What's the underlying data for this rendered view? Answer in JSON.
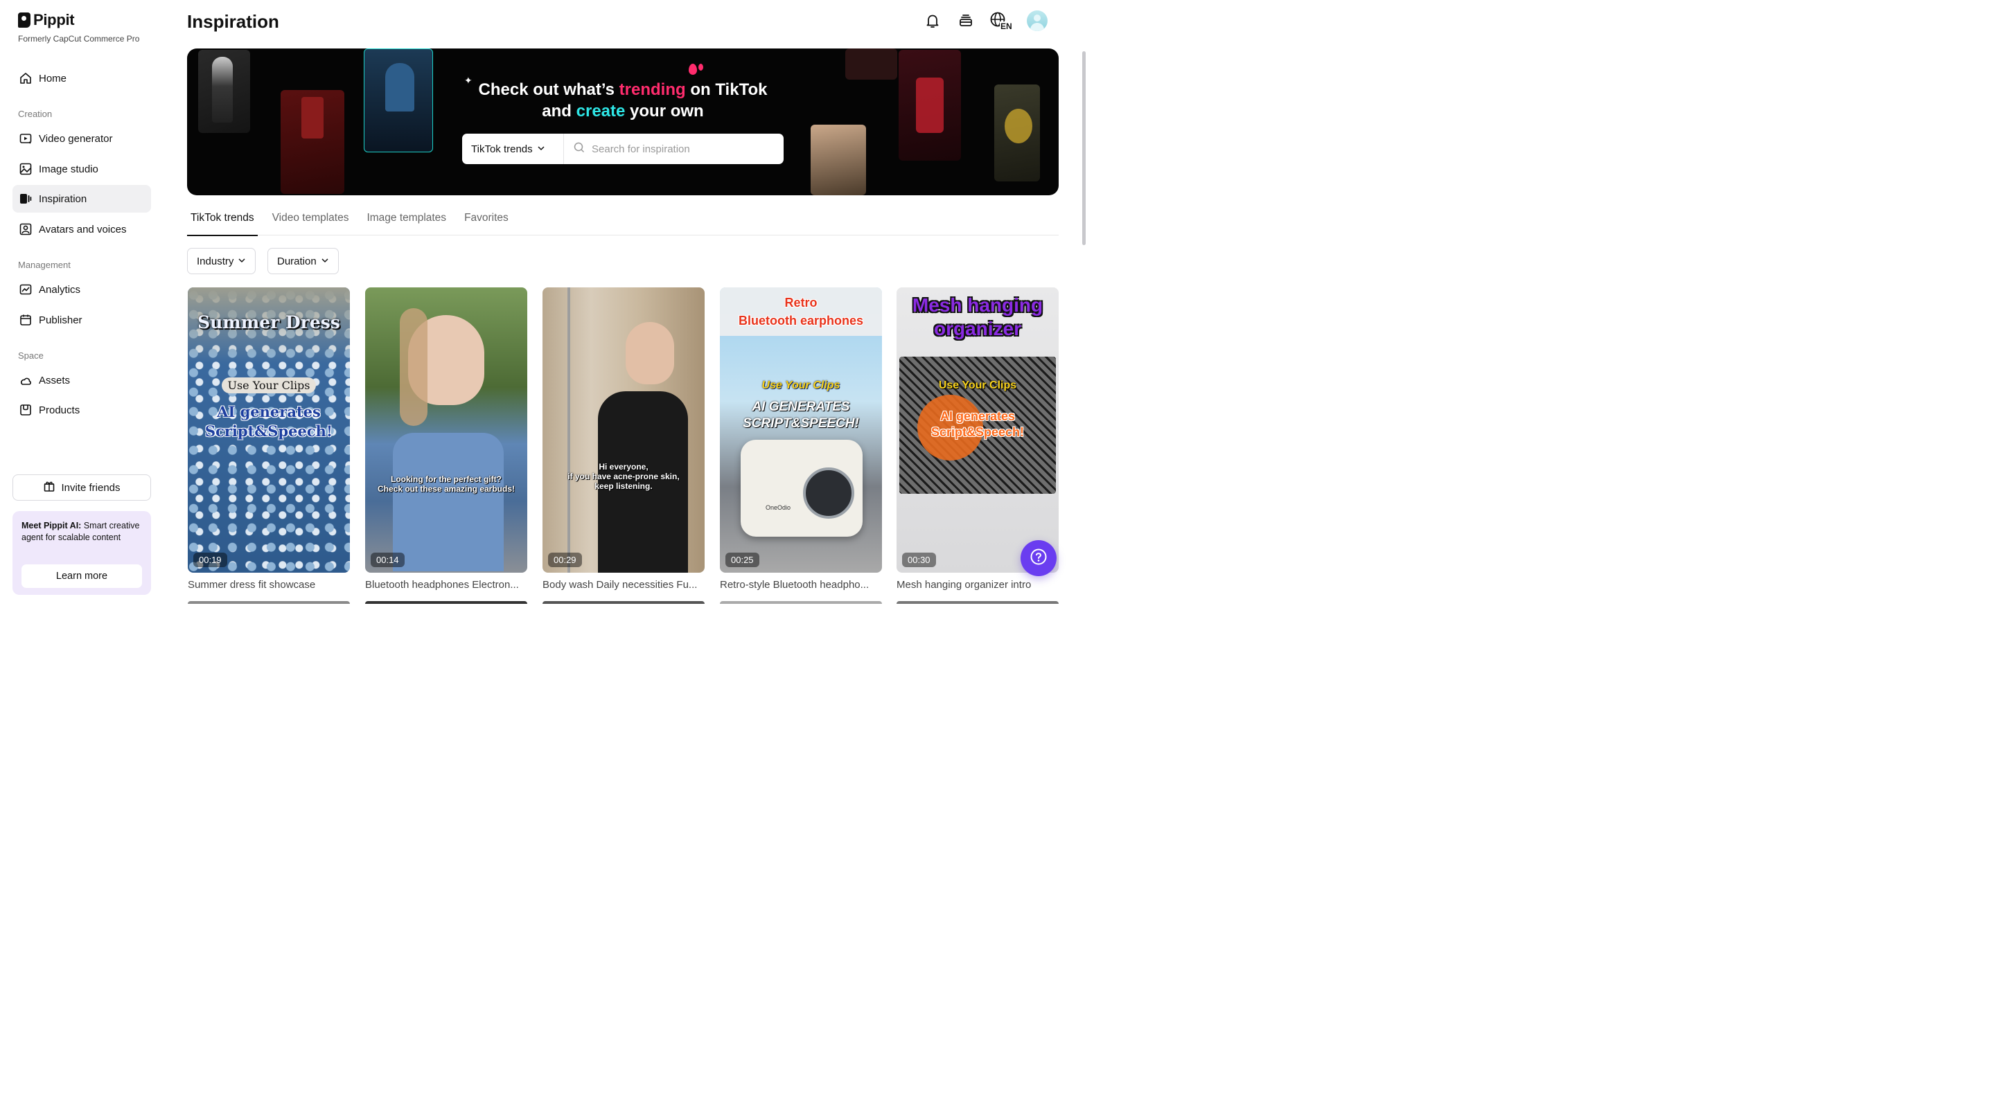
{
  "app": {
    "name": "Pippit",
    "subtitle": "Formerly CapCut Commerce Pro"
  },
  "sidebar": {
    "home": "Home",
    "sections": {
      "creation": "Creation",
      "management": "Management",
      "space": "Space"
    },
    "creation_items": [
      "Video generator",
      "Image studio",
      "Inspiration",
      "Avatars and voices"
    ],
    "management_items": [
      "Analytics",
      "Publisher"
    ],
    "space_items": [
      "Assets",
      "Products"
    ],
    "active_item": "Inspiration",
    "invite_label": "Invite friends",
    "promo": {
      "bold": "Meet Pippit AI:",
      "text": " Smart creative agent for scalable content",
      "button": "Learn more"
    }
  },
  "header": {
    "title": "Inspiration",
    "icons": [
      "bell-icon",
      "layers-icon",
      "globe-language-icon",
      "avatar"
    ],
    "language": "EN"
  },
  "banner": {
    "line1_a": "Check out what’s ",
    "line1_b": "trending",
    "line1_c": " on TikTok",
    "line2_a": "and ",
    "line2_b": "create",
    "line2_c": " your own",
    "accent_pink": "#ff2c6d",
    "accent_cyan": "#2ee6e6",
    "select_value": "TikTok trends",
    "search_placeholder": "Search for inspiration"
  },
  "tabs": [
    "TikTok trends",
    "Video templates",
    "Image templates",
    "Favorites"
  ],
  "active_tab": "TikTok trends",
  "filters": [
    "Industry",
    "Duration"
  ],
  "cards": [
    {
      "title": "Summer dress fit showcase",
      "duration": "00:19",
      "overlay": [
        "Summer Dress",
        "Use Your Clips",
        "AI generates",
        "Script&Speech!"
      ]
    },
    {
      "title": "Bluetooth headphones Electron...",
      "duration": "00:14",
      "overlay": [
        "Looking for the perfect gift?",
        "Check out these amazing earbuds!"
      ]
    },
    {
      "title": "Body wash Daily necessities Fu...",
      "duration": "00:29",
      "overlay": [
        "Hi everyone,",
        "if you have acne-prone skin,",
        "keep listening."
      ]
    },
    {
      "title": "Retro-style Bluetooth headpho...",
      "duration": "00:25",
      "overlay": [
        "Retro",
        "Bluetooth earphones",
        "Use Your Clips",
        "AI GENERATES",
        "SCRIPT&SPEECH!",
        "OneOdio"
      ]
    },
    {
      "title": "Mesh hanging organizer intro",
      "duration": "00:30",
      "overlay": [
        "Mesh hanging",
        "organizer",
        "Use Your Clips",
        "AI generates",
        "Script&Speech!"
      ]
    }
  ],
  "help_button": "help-icon",
  "brand_colors": {
    "help_purple": "#6a3df0",
    "promo_bg": "#efe8fb"
  }
}
